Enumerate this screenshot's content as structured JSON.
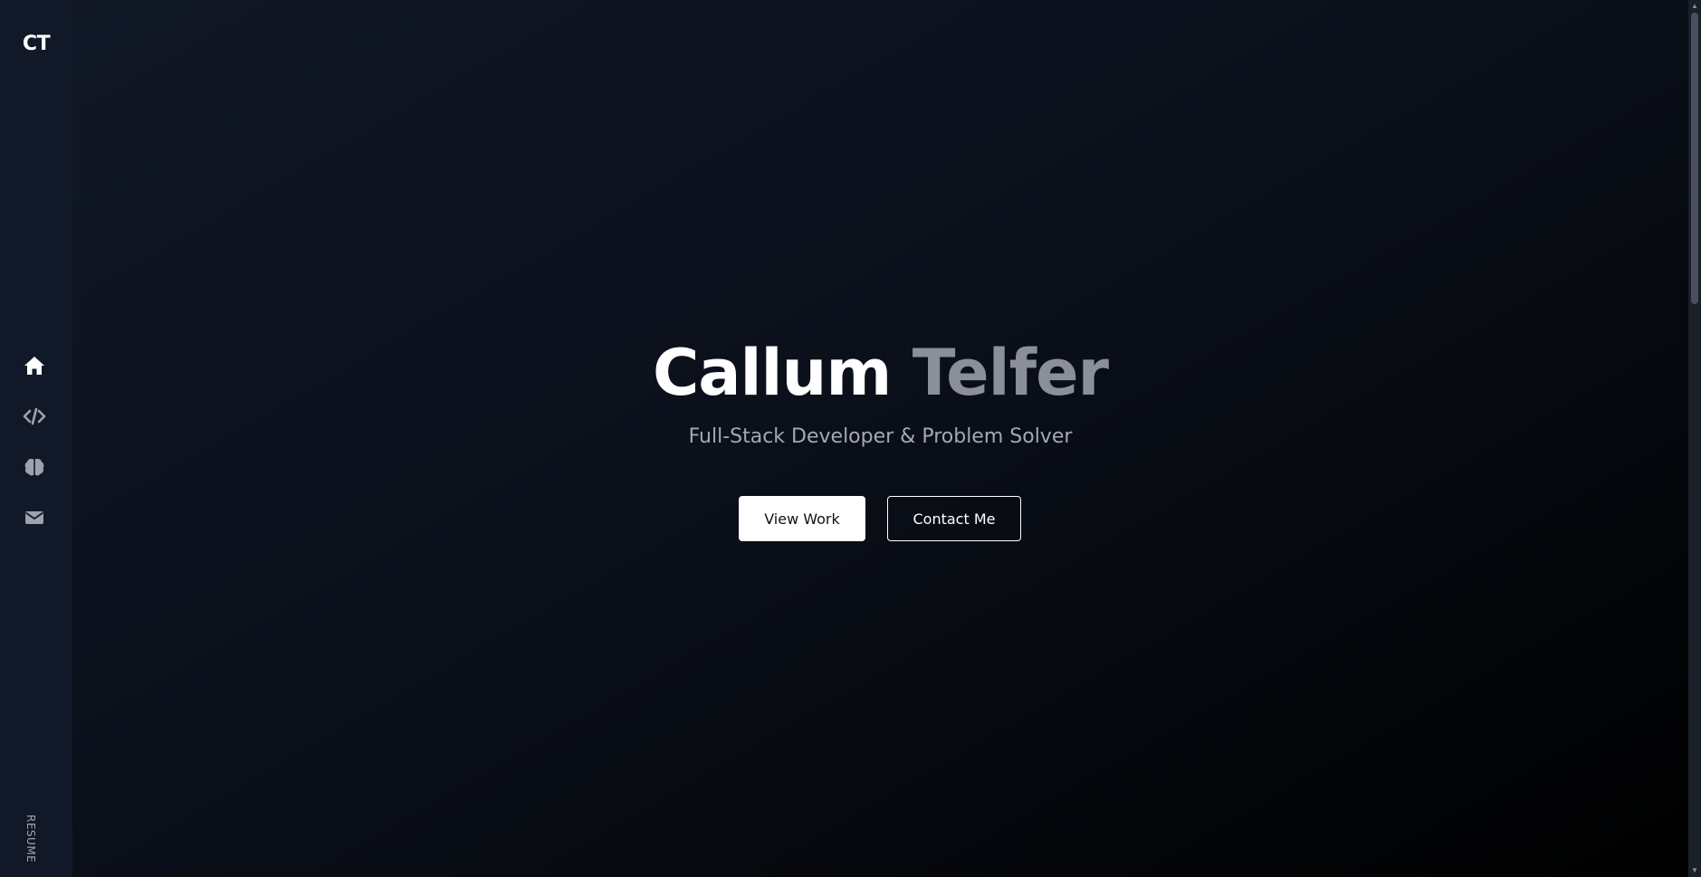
{
  "sidebar": {
    "logo": "CT",
    "nav": [
      {
        "name": "home",
        "icon": "home-icon",
        "active": true
      },
      {
        "name": "code",
        "icon": "code-icon",
        "active": false
      },
      {
        "name": "brain",
        "icon": "brain-icon",
        "active": false
      },
      {
        "name": "contact",
        "icon": "envelope-icon",
        "active": false
      }
    ],
    "resume_label": "RESUME"
  },
  "hero": {
    "title_first": "Callum",
    "title_last": "Telfer",
    "subtitle": "Full-Stack Developer & Problem Solver",
    "primary_button": "View Work",
    "secondary_button": "Contact Me"
  },
  "colors": {
    "sidebar_bg": "#111827",
    "background_start": "#111827",
    "background_end": "#000000",
    "accent_text": "#ffffff",
    "muted_title": "#8b8f9b",
    "subtitle": "#a3a8b3",
    "icon_active": "#ffffff",
    "icon_inactive": "#9ca3af"
  }
}
